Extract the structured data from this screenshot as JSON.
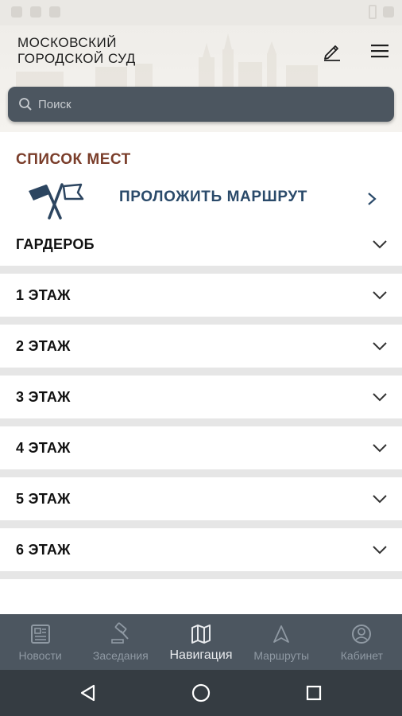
{
  "app": {
    "title_line1": "МОСКОВСКИЙ",
    "title_line2": "ГОРОДСКОЙ СУД"
  },
  "header": {
    "edit_icon": "pencil-icon",
    "menu_icon": "hamburger-menu-icon"
  },
  "search": {
    "placeholder": "Поиск",
    "value": "",
    "icon": "search-icon"
  },
  "places": {
    "section_title": "СПИСОК МЕСТ",
    "route_label": "ПРОЛОЖИТЬ МАРШРУТ",
    "items": [
      {
        "label": "ГАРДЕРОБ"
      },
      {
        "label": "1 ЭТАЖ"
      },
      {
        "label": "2 ЭТАЖ"
      },
      {
        "label": "3 ЭТАЖ"
      },
      {
        "label": "4 ЭТАЖ"
      },
      {
        "label": "5 ЭТАЖ"
      },
      {
        "label": "6 ЭТАЖ"
      }
    ]
  },
  "bottom_nav": {
    "items": [
      {
        "label": "Новости",
        "icon": "newspaper-icon",
        "active": false
      },
      {
        "label": "Заседания",
        "icon": "gavel-icon",
        "active": false
      },
      {
        "label": "Навигация",
        "icon": "map-icon",
        "active": true
      },
      {
        "label": "Маршруты",
        "icon": "navigation-arrow-icon",
        "active": false
      },
      {
        "label": "Кабинет",
        "icon": "account-icon",
        "active": false
      }
    ]
  },
  "colors": {
    "accent_dark": "#4c5660",
    "section_title": "#7a3d2a",
    "route_text": "#2a4a6a",
    "nav_active": "#e9ebee",
    "nav_inactive": "#8f99a3"
  }
}
